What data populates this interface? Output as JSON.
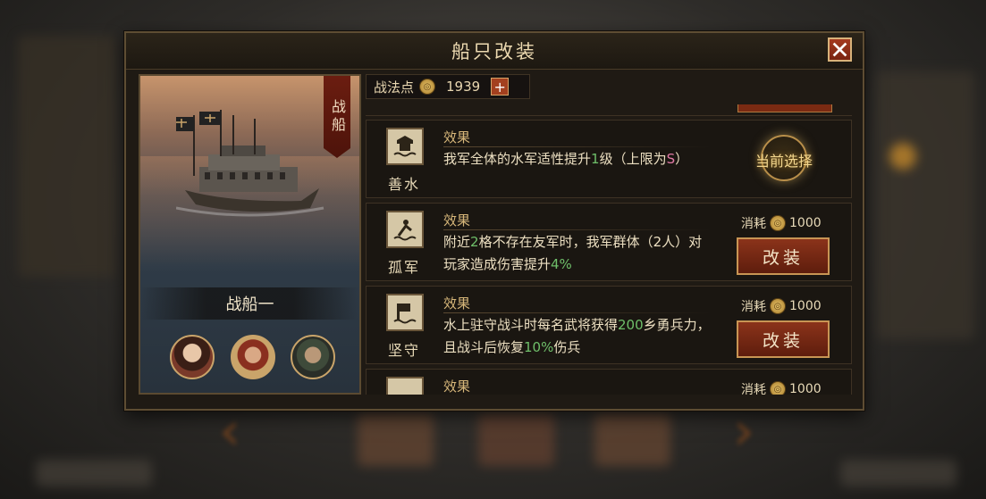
{
  "dialog": {
    "title": "船只改装"
  },
  "ship": {
    "type_label": "战船",
    "name": "战船一",
    "generals": [
      "general-1",
      "general-2",
      "general-3"
    ]
  },
  "points": {
    "label": "战法点",
    "value": "1939",
    "plus": "+"
  },
  "modifications": [
    {
      "name": "善水",
      "effect_label": "效果",
      "desc_parts": [
        "我军全体的水军适性提升",
        "1",
        "级（上限为",
        "S",
        "）"
      ],
      "status": "当前选择"
    },
    {
      "name": "孤军",
      "effect_label": "效果",
      "desc_parts": [
        "附近",
        "2",
        "格不存在友军时，我军群体（2人）对玩家造成伤害提升",
        "4%"
      ],
      "cost_label": "消耗",
      "cost_value": "1000",
      "button": "改装"
    },
    {
      "name": "坚守",
      "effect_label": "效果",
      "desc_parts": [
        "水上驻守战斗时每名武将获得",
        "200",
        "乡勇兵力，且战斗后恢复",
        "10%",
        "伤兵"
      ],
      "cost_label": "消耗",
      "cost_value": "1000",
      "button": "改装"
    },
    {
      "name": "",
      "effect_label": "效果",
      "cost_label": "消耗",
      "cost_value": "1000"
    }
  ],
  "colors": {
    "accent_green": "#6fbf6a",
    "accent_pink": "#e27aa6",
    "button_red": "#8b331a",
    "gold": "#c89554"
  }
}
